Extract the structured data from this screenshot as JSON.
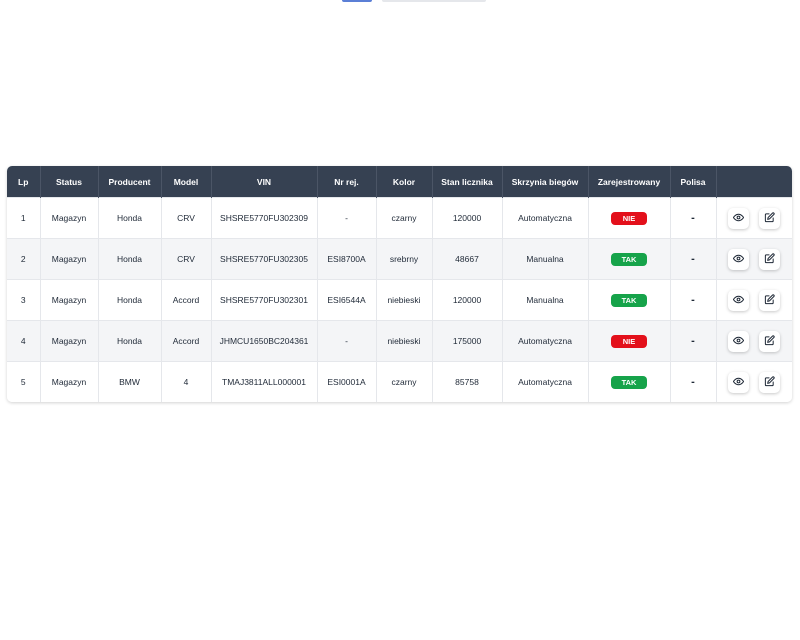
{
  "table": {
    "columns": [
      "Lp",
      "Status",
      "Producent",
      "Model",
      "VIN",
      "Nr rej.",
      "Kolor",
      "Stan licznika",
      "Skrzynia biegów",
      "Zarejestrowany",
      "Polisa",
      ""
    ],
    "rows": [
      {
        "lp": "1",
        "status": "Magazyn",
        "producent": "Honda",
        "model": "CRV",
        "vin": "SHSRE5770FU302309",
        "nr_rej": "-",
        "kolor": "czarny",
        "stan_licznika": "120000",
        "skrzynia": "Automatyczna",
        "zarejestrowany": "NIE",
        "polisa": "-"
      },
      {
        "lp": "2",
        "status": "Magazyn",
        "producent": "Honda",
        "model": "CRV",
        "vin": "SHSRE5770FU302305",
        "nr_rej": "ESI8700A",
        "kolor": "srebrny",
        "stan_licznika": "48667",
        "skrzynia": "Manualna",
        "zarejestrowany": "TAK",
        "polisa": "-"
      },
      {
        "lp": "3",
        "status": "Magazyn",
        "producent": "Honda",
        "model": "Accord",
        "vin": "SHSRE5770FU302301",
        "nr_rej": "ESI6544A",
        "kolor": "niebieski",
        "stan_licznika": "120000",
        "skrzynia": "Manualna",
        "zarejestrowany": "TAK",
        "polisa": "-"
      },
      {
        "lp": "4",
        "status": "Magazyn",
        "producent": "Honda",
        "model": "Accord",
        "vin": "JHMCU1650BC204361",
        "nr_rej": "-",
        "kolor": "niebieski",
        "stan_licznika": "175000",
        "skrzynia": "Automatyczna",
        "zarejestrowany": "NIE",
        "polisa": "-"
      },
      {
        "lp": "5",
        "status": "Magazyn",
        "producent": "BMW",
        "model": "4",
        "vin": "TMAJ3811ALL000001",
        "nr_rej": "ESI0001A",
        "kolor": "czarny",
        "stan_licznika": "85758",
        "skrzynia": "Automatyczna",
        "zarejestrowany": "TAK",
        "polisa": "-"
      }
    ]
  },
  "icons": {
    "view": "eye-icon",
    "edit": "edit-icon"
  },
  "colors": {
    "header_bg": "#364152",
    "badge_no": "#e3101b",
    "badge_yes": "#16a34a",
    "row_alt": "#f4f5f7"
  }
}
